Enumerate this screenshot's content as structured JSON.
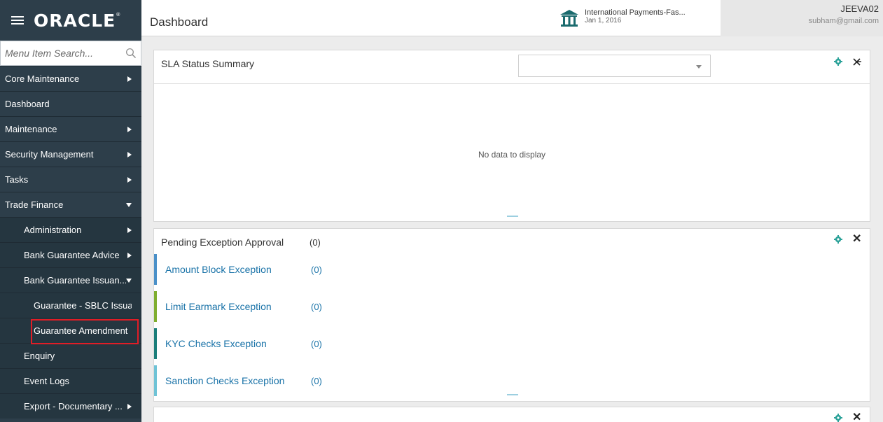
{
  "brand": {
    "logo": "ORACLE",
    "trademark": "®"
  },
  "search": {
    "placeholder": "Menu Item Search..."
  },
  "menu": [
    {
      "label": "Core Maintenance",
      "level": 0,
      "arrow": "right"
    },
    {
      "label": "Dashboard",
      "level": 0,
      "arrow": "none"
    },
    {
      "label": "Maintenance",
      "level": 0,
      "arrow": "right"
    },
    {
      "label": "Security Management",
      "level": 0,
      "arrow": "right"
    },
    {
      "label": "Tasks",
      "level": 0,
      "arrow": "right"
    },
    {
      "label": "Trade Finance",
      "level": 0,
      "arrow": "down"
    },
    {
      "label": "Administration",
      "level": 1,
      "arrow": "right"
    },
    {
      "label": "Bank Guarantee Advice",
      "level": 1,
      "arrow": "right"
    },
    {
      "label": "Bank Guarantee Issuan...",
      "level": 1,
      "arrow": "down"
    },
    {
      "label": "Guarantee - SBLC Issua...",
      "level": 2,
      "arrow": "none"
    },
    {
      "label": "Guarantee Amendment",
      "level": 2,
      "arrow": "none"
    },
    {
      "label": "Enquiry",
      "level": 1,
      "arrow": "none"
    },
    {
      "label": "Event Logs",
      "level": 1,
      "arrow": "none"
    },
    {
      "label": "Export - Documentary ...",
      "level": 1,
      "arrow": "right"
    }
  ],
  "header": {
    "title": "Dashboard",
    "branch_name": "International Payments-Fas...",
    "branch_date": "Jan 1, 2016",
    "user_id": "JEEVA02",
    "user_email": "subham@gmail.com"
  },
  "sla_panel": {
    "title": "SLA Status Summary",
    "dropdown_value": "",
    "empty_text": "No data to display"
  },
  "exception_panel": {
    "title": "Pending Exception Approval",
    "count": "(0)",
    "rows": [
      {
        "name": "Amount Block Exception",
        "count": "(0)",
        "color": "#4a90c8"
      },
      {
        "name": "Limit Earmark Exception",
        "count": "(0)",
        "color": "#7fae2f"
      },
      {
        "name": "KYC Checks Exception",
        "count": "(0)",
        "color": "#1b7e7a"
      },
      {
        "name": "Sanction Checks Exception",
        "count": "(0)",
        "color": "#6fc3d6"
      }
    ]
  },
  "colors": {
    "sidebar": "#2d3e4a",
    "accent": "#1a73a8",
    "highlight": "#e21d26",
    "gear": "#2aa198"
  }
}
